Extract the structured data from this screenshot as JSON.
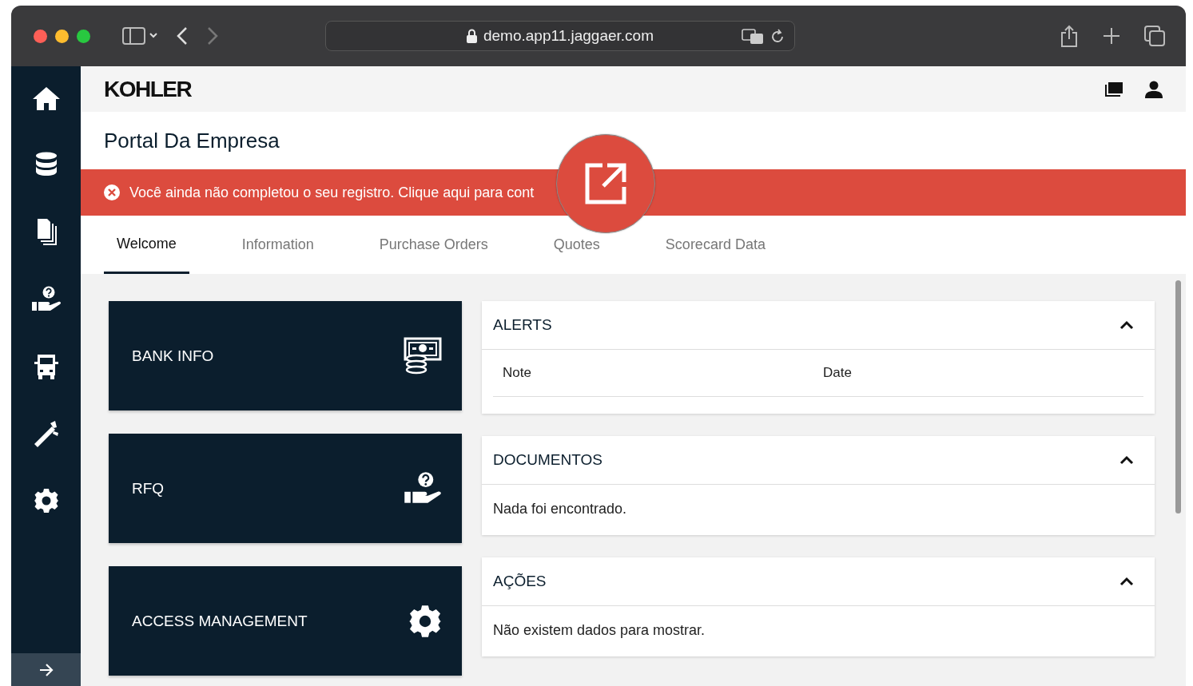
{
  "browser": {
    "url": "demo.app11.jaggaer.com"
  },
  "header": {
    "logo": "KOHLER"
  },
  "page": {
    "title": "Portal Da Empresa"
  },
  "banner": {
    "text": "Você ainda não completou o seu registro. Clique aqui para cont"
  },
  "tabs": [
    {
      "label": "Welcome",
      "selected": true
    },
    {
      "label": "Information",
      "selected": false
    },
    {
      "label": "Purchase Orders",
      "selected": false
    },
    {
      "label": "Quotes",
      "selected": false
    },
    {
      "label": "Scorecard Data",
      "selected": false
    }
  ],
  "tiles": [
    {
      "label": "BANK INFO",
      "kind": "bank"
    },
    {
      "label": "RFQ",
      "kind": "rfq"
    },
    {
      "label": "ACCESS MANAGEMENT",
      "kind": "access"
    }
  ],
  "panels": [
    {
      "title": "ALERTS",
      "expanded": true,
      "columns": [
        "Note",
        "Date"
      ]
    },
    {
      "title": "DOCUMENTOS",
      "expanded": true,
      "message": "Nada foi encontrado."
    },
    {
      "title": "AÇÕES",
      "expanded": true,
      "message": "Não existem dados para mostrar."
    }
  ]
}
